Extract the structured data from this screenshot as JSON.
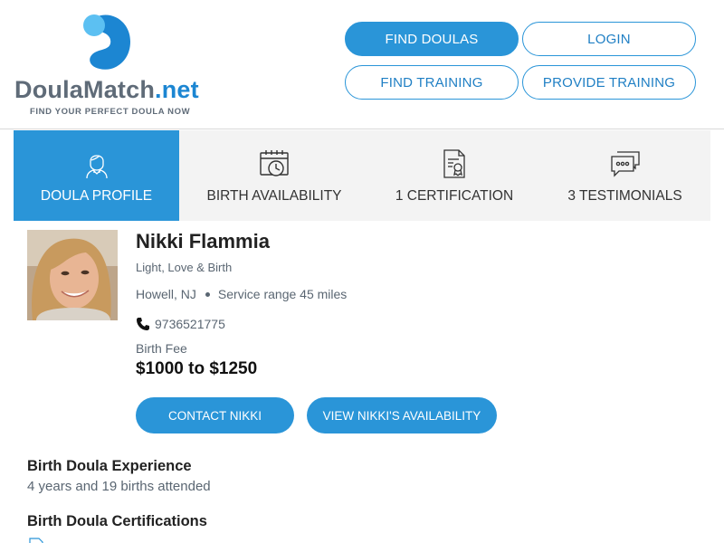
{
  "brand": {
    "name_main": "DoulaMatch",
    "name_suffix": ".net",
    "tagline": "FIND YOUR PERFECT DOULA NOW",
    "colors": {
      "primary": "#2a95d8",
      "logo_gray": "#5f6b78",
      "tab_bg": "#f3f3f3"
    }
  },
  "nav": {
    "find_doulas": "FIND DOULAS",
    "login": "LOGIN",
    "find_training": "FIND TRAINING",
    "provide_training": "PROVIDE TRAINING"
  },
  "tabs": [
    {
      "label": "DOULA PROFILE",
      "icon": "doula-person-icon",
      "active": true
    },
    {
      "label": "BIRTH AVAILABILITY",
      "icon": "calendar-clock-icon",
      "active": false
    },
    {
      "label": "1 CERTIFICATION",
      "icon": "certificate-icon",
      "active": false
    },
    {
      "label": "3 TESTIMONIALS",
      "icon": "chat-bubbles-icon",
      "active": false
    }
  ],
  "profile": {
    "name": "Nikki Flammia",
    "business": "Light, Love & Birth",
    "location": "Howell, NJ",
    "service_range": "Service range 45 miles",
    "phone": "9736521775",
    "fee_label": "Birth Fee",
    "fee_value": "$1000 to $1250",
    "contact_button": "CONTACT NIKKI",
    "availability_button": "VIEW NIKKI'S AVAILABILITY"
  },
  "sections": {
    "experience_heading": "Birth Doula Experience",
    "experience_text": "4 years and 19 births attended",
    "certifications_heading": "Birth Doula Certifications"
  }
}
